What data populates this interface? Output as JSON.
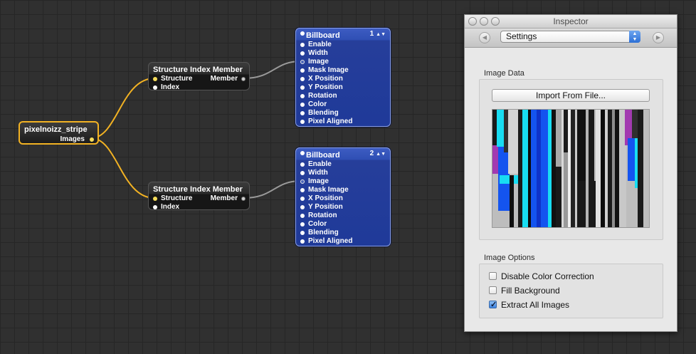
{
  "source_node": {
    "title": "pixelnoizz_stripe",
    "port_images": "Images"
  },
  "structure_nodes": [
    {
      "title": "Structure Index Member",
      "in_structure": "Structure",
      "in_index": "Index",
      "out_member": "Member"
    },
    {
      "title": "Structure Index Member",
      "in_structure": "Structure",
      "in_index": "Index",
      "out_member": "Member"
    }
  ],
  "billboard_nodes": [
    {
      "title": "Billboard",
      "layer": "1",
      "ports": [
        "Enable",
        "Width",
        "Image",
        "Mask Image",
        "X Position",
        "Y Position",
        "Rotation",
        "Color",
        "Blending",
        "Pixel Aligned"
      ]
    },
    {
      "title": "Billboard",
      "layer": "2",
      "ports": [
        "Enable",
        "Width",
        "Image",
        "Mask Image",
        "X Position",
        "Y Position",
        "Rotation",
        "Color",
        "Blending",
        "Pixel Aligned"
      ]
    }
  ],
  "inspector": {
    "title": "Inspector",
    "selector_value": "Settings",
    "image_data_label": "Image Data",
    "import_button": "Import From File...",
    "image_options_label": "Image Options",
    "options": [
      {
        "label": "Disable Color Correction",
        "checked": false
      },
      {
        "label": "Fill Background",
        "checked": false
      },
      {
        "label": "Extract All Images",
        "checked": true
      }
    ]
  },
  "colors": {
    "wire_yellow": "#f2b223",
    "wire_gray": "#9a9a9a",
    "billboard_blue": "#2a47a8",
    "accent_blue": "#2c6fd6"
  }
}
